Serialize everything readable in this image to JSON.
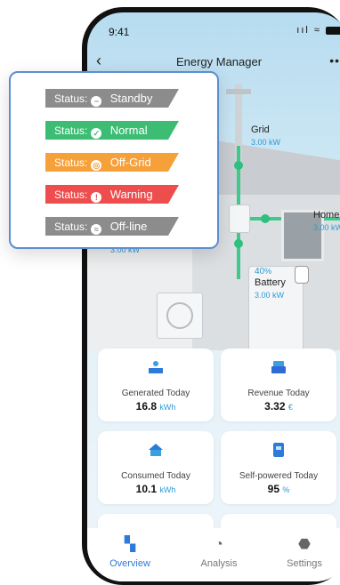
{
  "statusbar": {
    "time": "9:41",
    "signal": "..ıl",
    "wifi": "≈"
  },
  "nav": {
    "title": "Energy Manager",
    "back": "‹",
    "more": "•••"
  },
  "diagram": {
    "grid": {
      "label": "Grid",
      "value": "3.00",
      "unit": "kW"
    },
    "home": {
      "label": "Home",
      "value": "3.00",
      "unit": "kW"
    },
    "battery": {
      "label": "Battery",
      "percent": "40",
      "percent_unit": "%",
      "value": "3.00",
      "unit": "kW"
    },
    "solar": {
      "value": "3.00",
      "unit": "kW"
    }
  },
  "cards": [
    {
      "label": "Generated Today",
      "value": "16.8",
      "unit": "kWh",
      "icon": "solar-panel-icon"
    },
    {
      "label": "Revenue Today",
      "value": "3.32",
      "unit": "€",
      "icon": "revenue-icon"
    },
    {
      "label": "Consumed Today",
      "value": "10.1",
      "unit": "kWh",
      "icon": "house-consumption-icon"
    },
    {
      "label": "Self-powered Today",
      "value": "95",
      "unit": "%",
      "icon": "self-powered-icon"
    }
  ],
  "tabs": [
    {
      "label": "Overview",
      "icon": "overview-icon",
      "active": true
    },
    {
      "label": "Analysis",
      "icon": "pie-chart-icon",
      "active": false
    },
    {
      "label": "Settings",
      "icon": "gear-icon",
      "active": false
    }
  ],
  "popup": {
    "prefix": "Status:",
    "items": [
      {
        "value": "Standby",
        "color": "#8c8c8c",
        "icon": "minus-circle-icon",
        "glyph": "−"
      },
      {
        "value": "Normal",
        "color": "#3dbd74",
        "icon": "check-circle-icon",
        "glyph": "✓"
      },
      {
        "value": "Off-Grid",
        "color": "#f6a03a",
        "icon": "off-grid-circle-icon",
        "glyph": "◎"
      },
      {
        "value": "Warning",
        "color": "#ee4d4d",
        "icon": "alert-circle-icon",
        "glyph": "!"
      },
      {
        "value": "Off-line",
        "color": "#8c8c8c",
        "icon": "wifi-off-circle-icon",
        "glyph": "≈"
      }
    ]
  },
  "colors": {
    "accent": "#2e7ad8",
    "value_blue": "#2e9ad6",
    "flow_green": "#3fc98a"
  }
}
